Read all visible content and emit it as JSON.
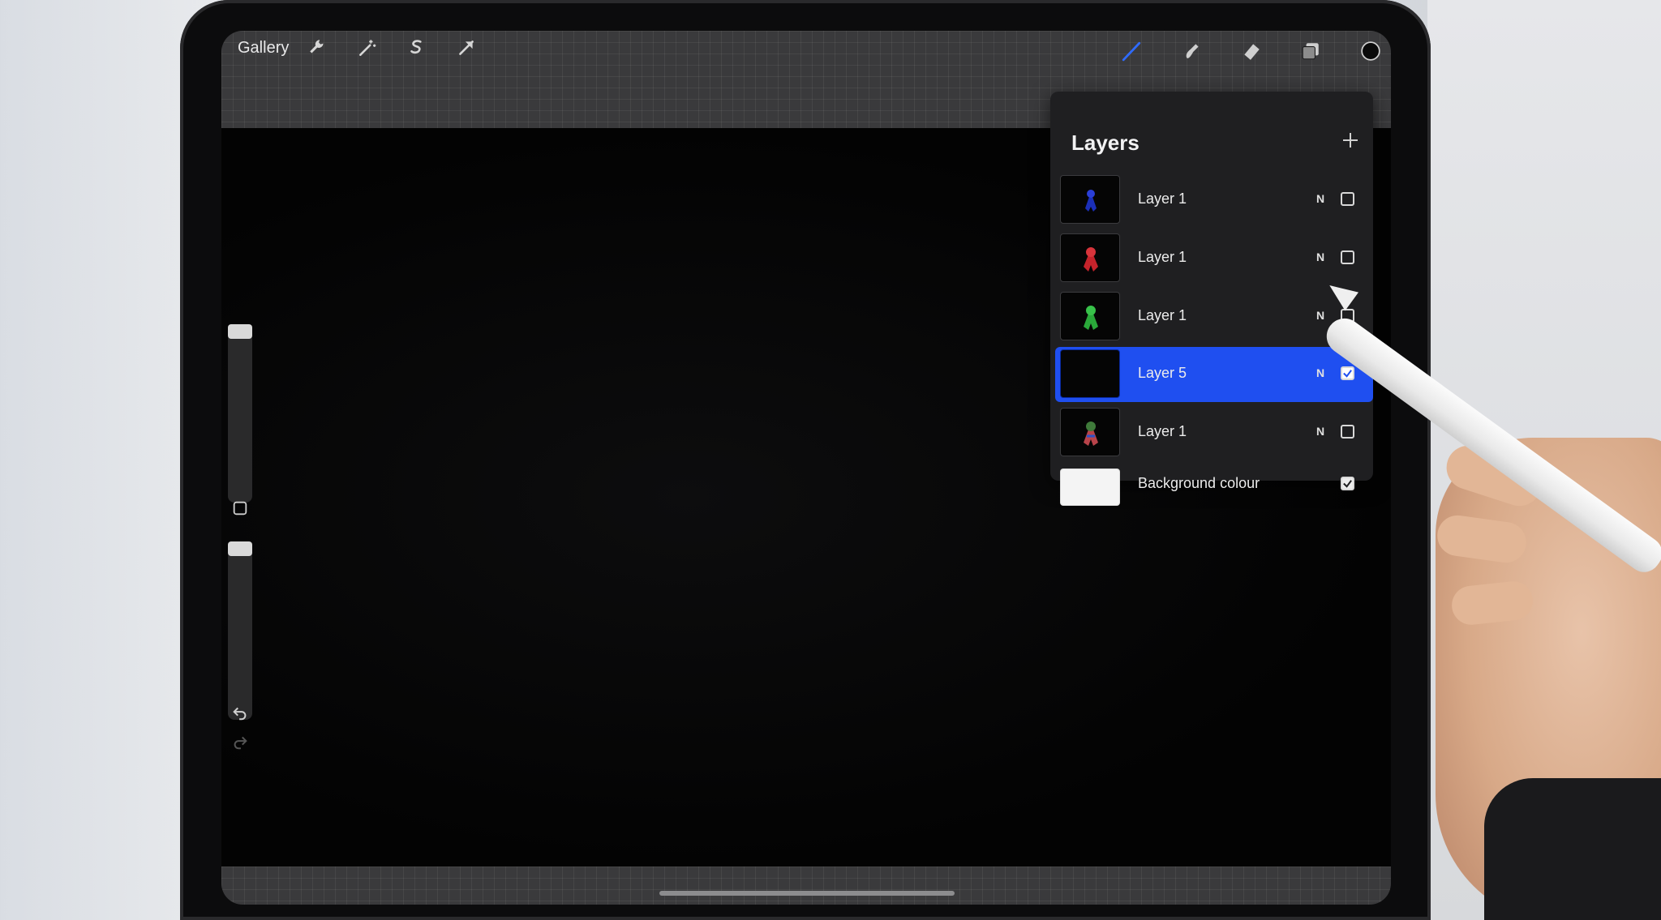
{
  "toolbar": {
    "gallery_label": "Gallery",
    "left_tools": [
      "wrench-icon",
      "magic-wand-icon",
      "selection-icon",
      "move-arrow-icon"
    ],
    "right_tools": [
      "brush-icon",
      "smudge-icon",
      "eraser-icon",
      "layers-icon",
      "color-swatch"
    ],
    "accent": "#2f6bff"
  },
  "layers_panel": {
    "title": "Layers",
    "add_icon": "plus-icon",
    "layers": [
      {
        "name": "Layer 1",
        "mode": "N",
        "visible": false,
        "selected": false,
        "thumb_color": "#1b2fb8"
      },
      {
        "name": "Layer 1",
        "mode": "N",
        "visible": false,
        "selected": false,
        "thumb_color": "#c4232b"
      },
      {
        "name": "Layer 1",
        "mode": "N",
        "visible": false,
        "selected": false,
        "thumb_color": "#2aa83a"
      },
      {
        "name": "Layer 5",
        "mode": "N",
        "visible": true,
        "selected": true,
        "thumb_color": "#050505"
      },
      {
        "name": "Layer 1",
        "mode": "N",
        "visible": false,
        "selected": false,
        "thumb_color": "#b8434a"
      }
    ],
    "background": {
      "name": "Background colour",
      "visible": true,
      "color": "#f4f4f4"
    },
    "selected_color": "#1f4ff0"
  },
  "sidebar": {
    "modify_icon": "square-icon",
    "undo_icon": "undo-icon",
    "redo_icon": "redo-icon"
  }
}
